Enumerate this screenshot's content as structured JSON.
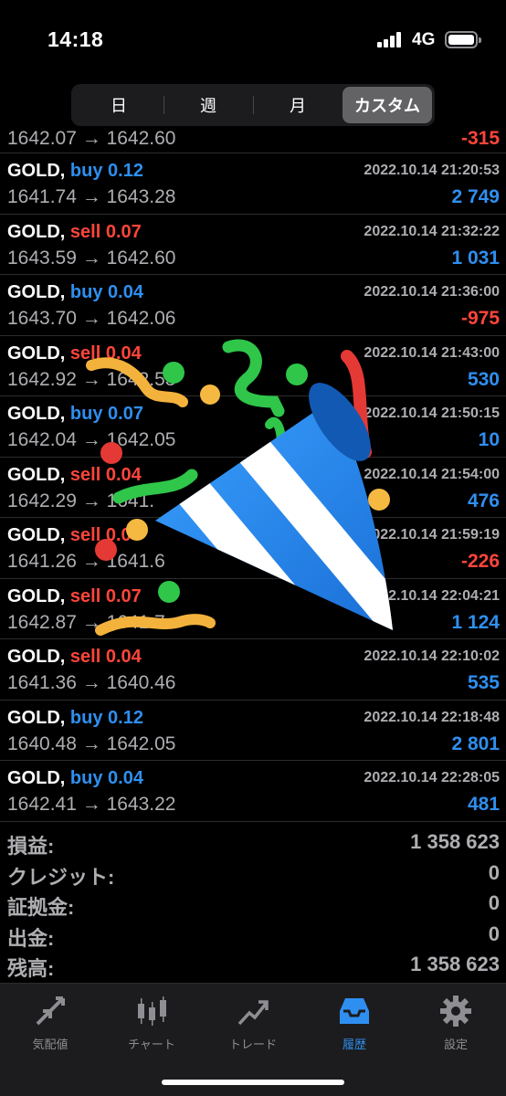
{
  "status": {
    "time": "14:18",
    "network": "4G"
  },
  "periods": [
    "日",
    "週",
    "月",
    "カスタム"
  ],
  "active_period": 3,
  "first_row": {
    "prices": "1642.07 → 1642.60",
    "profit": "-315",
    "profit_sign": "neg"
  },
  "trades": [
    {
      "symbol": "GOLD,",
      "side": "buy",
      "side_class": "buy",
      "volume": "0.12",
      "date": "2022.10.14 21:20:53",
      "prices": "1641.74 → 1643.28",
      "profit": "2 749",
      "profit_sign": "pos"
    },
    {
      "symbol": "GOLD,",
      "side": "sell",
      "side_class": "sell",
      "volume": "0.07",
      "date": "2022.10.14 21:32:22",
      "prices": "1643.59 → 1642.60",
      "profit": "1 031",
      "profit_sign": "pos"
    },
    {
      "symbol": "GOLD,",
      "side": "buy",
      "side_class": "buy",
      "volume": "0.04",
      "date": "2022.10.14 21:36:00",
      "prices": "1643.70 → 1642.06",
      "profit": "-975",
      "profit_sign": "neg"
    },
    {
      "symbol": "GOLD,",
      "side": "sell",
      "side_class": "sell",
      "volume": "0.04",
      "date": "2022.10.14 21:43:00",
      "prices": "1642.92 → 1642.53",
      "profit": "530",
      "profit_sign": "pos"
    },
    {
      "symbol": "GOLD,",
      "side": "buy",
      "side_class": "buy",
      "volume": "0.07",
      "date": "2022.10.14 21:50:15",
      "prices": "1642.04 → 1642.05",
      "profit": "10",
      "profit_sign": "pos"
    },
    {
      "symbol": "GOLD,",
      "side": "sell",
      "side_class": "sell",
      "volume": "0.04",
      "date": "2022.10.14 21:54:00",
      "prices": "1642.29 → 1641.",
      "profit": "476",
      "profit_sign": "pos"
    },
    {
      "symbol": "GOLD,",
      "side": "sell",
      "side_class": "sell",
      "volume": "0.0",
      "date": "2022.10.14 21:59:19",
      "prices": "1641.26 → 1641.6",
      "profit": "-226",
      "profit_sign": "neg"
    },
    {
      "symbol": "GOLD,",
      "side": "sell",
      "side_class": "sell",
      "volume": "0.07",
      "date": "2022.10.14 22:04:21",
      "prices": "1642.87 → 1641.7",
      "profit": "1 124",
      "profit_sign": "pos"
    },
    {
      "symbol": "GOLD,",
      "side": "sell",
      "side_class": "sell",
      "volume": "0.04",
      "date": "2022.10.14 22:10:02",
      "prices": "1641.36 → 1640.46",
      "profit": "535",
      "profit_sign": "pos"
    },
    {
      "symbol": "GOLD,",
      "side": "buy",
      "side_class": "buy",
      "volume": "0.12",
      "date": "2022.10.14 22:18:48",
      "prices": "1640.48 → 1642.05",
      "profit": "2 801",
      "profit_sign": "pos"
    },
    {
      "symbol": "GOLD,",
      "side": "buy",
      "side_class": "buy",
      "volume": "0.04",
      "date": "2022.10.14 22:28:05",
      "prices": "1642.41 → 1643.22",
      "profit": "481",
      "profit_sign": "pos"
    }
  ],
  "summary": [
    {
      "label": "損益:",
      "value": "1 358 623"
    },
    {
      "label": "クレジット:",
      "value": "0"
    },
    {
      "label": "証拠金:",
      "value": "0"
    },
    {
      "label": "出金:",
      "value": "0"
    },
    {
      "label": "残高:",
      "value": "1 358 623"
    }
  ],
  "tabs": [
    {
      "label": "気配値",
      "icon": "arrows-icon"
    },
    {
      "label": "チャート",
      "icon": "candlestick-icon"
    },
    {
      "label": "トレード",
      "icon": "trend-icon"
    },
    {
      "label": "履歴",
      "icon": "inbox-icon"
    },
    {
      "label": "設定",
      "icon": "gear-icon"
    }
  ],
  "active_tab": 3,
  "colors": {
    "buy": "#2f8ff0",
    "sell": "#ff453a",
    "accent": "#2f8ff0"
  },
  "overlay": {
    "emoji": "party-popper-icon"
  }
}
